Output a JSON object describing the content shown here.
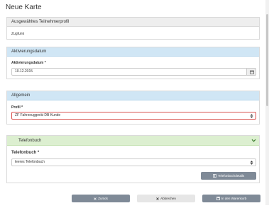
{
  "page": {
    "title": "Neue Karte"
  },
  "profile_panel": {
    "heading": "Ausgewähltes Teilnehmerprofil",
    "value": "Zugfunk"
  },
  "activation_panel": {
    "heading": "Aktivierungsdatum",
    "field_label": "Aktivierungsdatum",
    "required_mark": "*",
    "date_value": "10.12.2015"
  },
  "general_panel": {
    "heading": "Allgemein",
    "field_label": "Profil",
    "required_mark": "*",
    "selected_profile": "ZF Fahrzeuggerät DB Kunde"
  },
  "phonebook_panel": {
    "heading": "Telefonbuch",
    "field_label": "Telefonbuch",
    "required_mark": "*",
    "selected_phonebook": "leeres Telefonbuch",
    "details_button": "Telefonbuchdetails"
  },
  "footer": {
    "back_button": "Zurück",
    "cancel_button": "Abbrechen",
    "cart_button": "In den Warenkorb"
  },
  "colors": {
    "blue_header": "#d0e6f5",
    "green_header": "#dcefd0",
    "gray_header": "#eeeeee",
    "button_gray": "#7f8a97",
    "error_border": "#d9534f"
  },
  "icons": [
    "calendar-icon",
    "sort-icon",
    "chevron-down-icon",
    "book-icon",
    "close-icon",
    "save-icon"
  ]
}
